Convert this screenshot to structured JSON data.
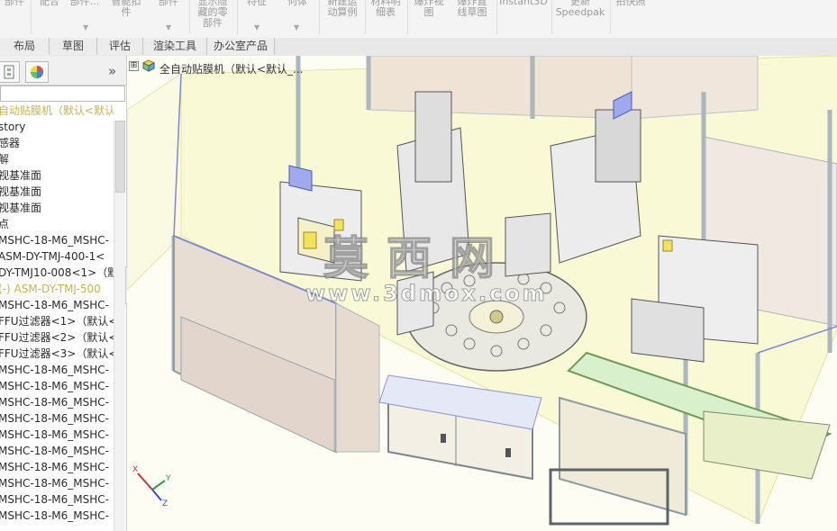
{
  "ribbon": {
    "buttons": [
      {
        "label": "部件"
      },
      {
        "label": "配合"
      },
      {
        "label": "部件..."
      },
      {
        "label": "智能扣\n件"
      },
      {
        "label": "部件"
      },
      {
        "label": "显示隐\n藏的零\n部件"
      },
      {
        "label": "特征"
      },
      {
        "label": "何体"
      },
      {
        "label": "新建运\n动算例"
      },
      {
        "label": "材料明\n细表"
      },
      {
        "label": "爆炸视\n图"
      },
      {
        "label": "爆炸直\n线草图"
      },
      {
        "label": "Instant3D"
      },
      {
        "label": "更新\nSpeedpak"
      },
      {
        "label": "拍快照"
      }
    ]
  },
  "tabs": [
    "布局",
    "草图",
    "评估",
    "渲染工具",
    "办公室产品"
  ],
  "panel": {
    "expand_symbol": "»",
    "tree": [
      "自动贴膜机（默认<默认",
      "story",
      "感器",
      "解",
      "视基准面",
      "视基准面",
      "视基准面",
      "点",
      "MSHC-18-M6_MSHC-",
      "ASM-DY-TMJ-400-1<",
      "DY-TMJ10-008<1>（默",
      "(-) ASM-DY-TMJ-500",
      "MSHC-18-M6_MSHC-",
      "FFU过滤器<1>（默认<",
      "FFU过滤器<2>（默认<",
      "FFU过滤器<3>（默认<",
      "MSHC-18-M6_MSHC-",
      "MSHC-18-M6_MSHC-",
      "MSHC-18-M6_MSHC-",
      "MSHC-18-M6_MSHC-",
      "MSHC-18-M6_MSHC-",
      "MSHC-18-M6_MSHC-",
      "MSHC-18-M6_MSHC-",
      "MSHC-18-M6_MSHC-",
      "MSHC-18-M6_MSHC-",
      "MSHC-18-M6_MSHC-"
    ],
    "highlight_rows": [
      0,
      11
    ]
  },
  "viewport": {
    "expand_symbol": "⊞",
    "model_title": "全自动贴膜机（默认<默认_...",
    "watermark_cn": "莫西网",
    "watermark_url": "www.3dmox.com",
    "triad_labels": {
      "x": "X",
      "y": "Y",
      "z": "Z"
    }
  },
  "colors": {
    "frame": "#a9b7bf",
    "glass": "#fbfbd9",
    "cabinet": "#efe7d6",
    "accent_blue": "#7b89d9",
    "highlight_text": "#c4b64a"
  }
}
